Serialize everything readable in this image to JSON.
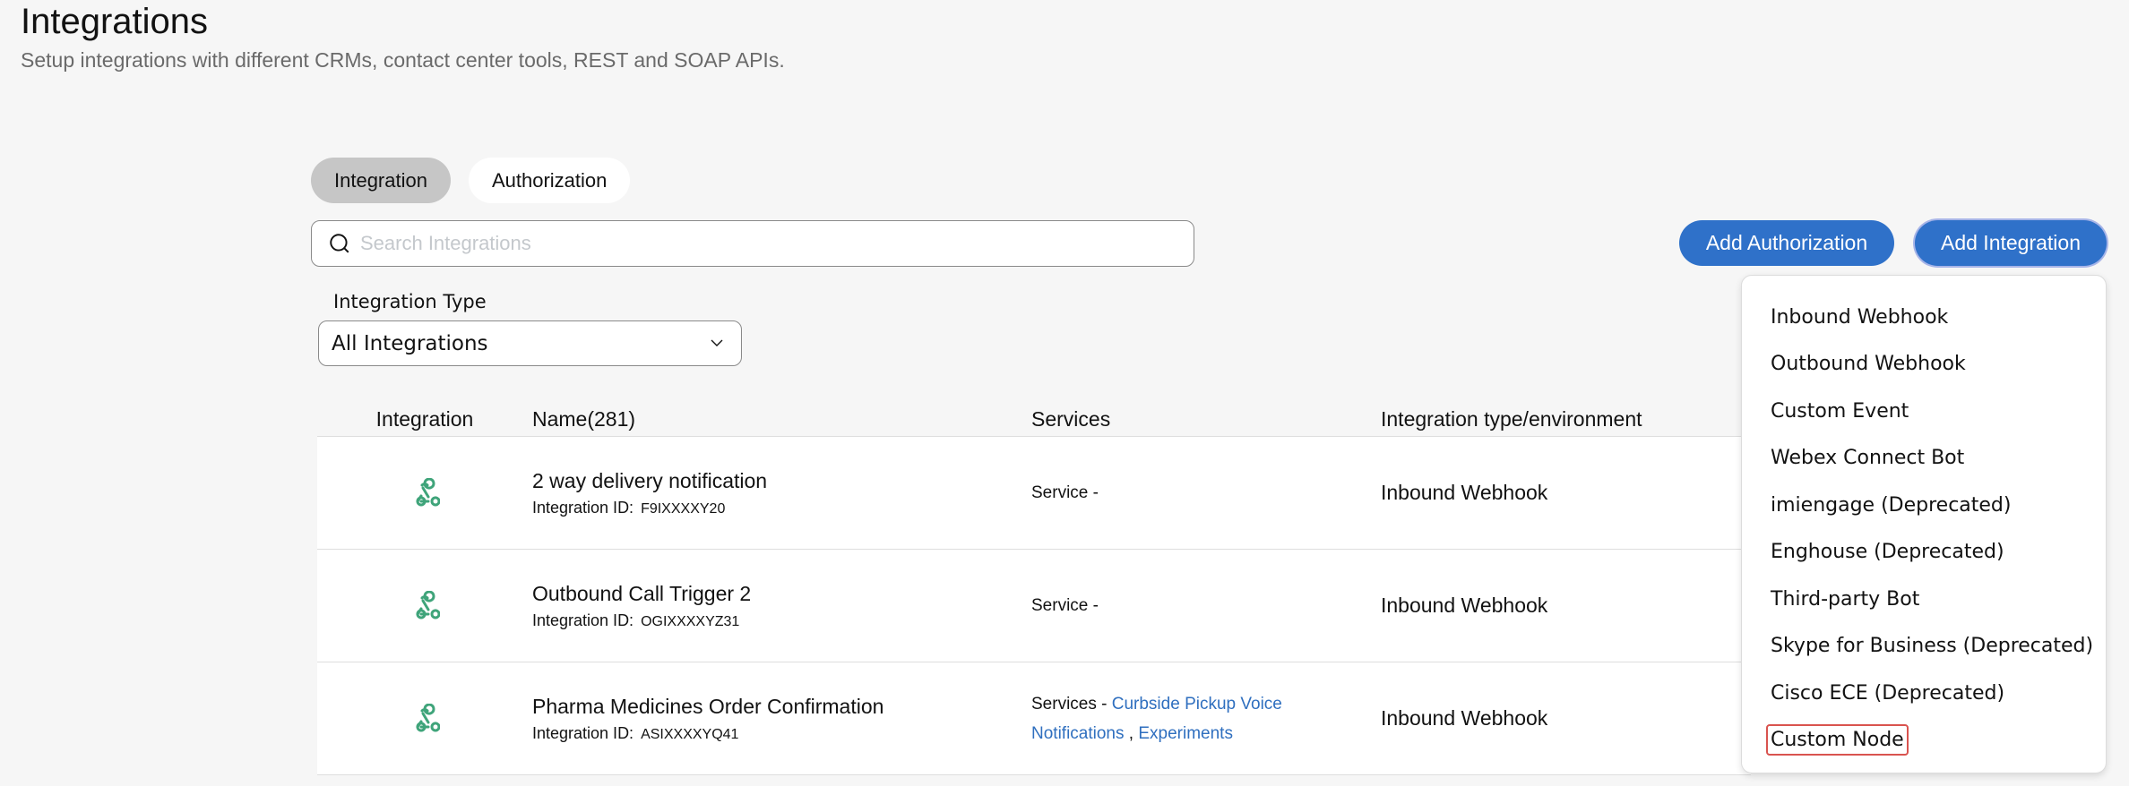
{
  "header": {
    "title": "Integrations",
    "subtitle": "Setup integrations with different CRMs, contact center tools, REST and SOAP APIs."
  },
  "tabs": [
    {
      "label": "Integration",
      "active": true
    },
    {
      "label": "Authorization",
      "active": false
    }
  ],
  "search": {
    "placeholder": "Search Integrations",
    "value": "",
    "icon": "search-icon"
  },
  "actions": {
    "add_authorization": "Add Authorization",
    "add_integration": "Add Integration"
  },
  "filter": {
    "label": "Integration Type",
    "selected": "All Integrations",
    "icon": "chevron-down-icon"
  },
  "table": {
    "columns": [
      "Integration",
      "Name(281)",
      "Services",
      "Integration type/environment"
    ],
    "id_label": "Integration ID:",
    "rows": [
      {
        "icon": "webhook-icon",
        "name": "2 way delivery notification",
        "id": "F9IXXXXY20",
        "services_prefix": "Service -",
        "service_links": [],
        "type": "Inbound Webhook"
      },
      {
        "icon": "webhook-icon",
        "name": "Outbound Call Trigger 2",
        "id": "OGIXXXXYZ31",
        "services_prefix": "Service -",
        "service_links": [],
        "type": "Inbound Webhook"
      },
      {
        "icon": "webhook-icon",
        "name": "Pharma Medicines Order Confirmation",
        "id": "ASIXXXXYQ41",
        "services_prefix": "Services -",
        "service_links": [
          "Curbside Pickup Voice Notifications",
          "Experiments"
        ],
        "separator": ",",
        "type": "Inbound Webhook"
      }
    ]
  },
  "add_integration_menu": {
    "items": [
      "Inbound Webhook",
      "Outbound Webhook",
      "Custom Event",
      "Webex Connect Bot",
      "imiengage (Deprecated)",
      "Enghouse (Deprecated)",
      "Third-party Bot",
      "Skype for Business (Deprecated)",
      "Cisco ECE (Deprecated)",
      "Custom Node"
    ],
    "highlighted": "Custom Node"
  },
  "colors": {
    "primary": "#2f71c9",
    "link": "#2f6fbf",
    "icon_green": "#3fa47a",
    "highlight_border": "#d9534f",
    "background": "#f6f6f6"
  }
}
